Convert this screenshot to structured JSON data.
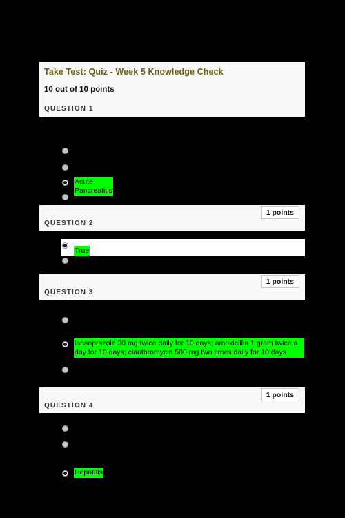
{
  "header": {
    "test_title": "Take Test: Quiz - Week 5 Knowledge Check",
    "points_total": "10 out of 10 points"
  },
  "colors": {
    "page_background": "#000000",
    "panel_background": "#f8f8f8",
    "title_color": "#6b5f15",
    "highlight_green": "#00ff00",
    "label_color": "#3a3a3a"
  },
  "questions": [
    {
      "label": "QUESTION 1",
      "points": "",
      "options": [
        {
          "text": "",
          "selected": false
        },
        {
          "text": "",
          "selected": false
        },
        {
          "text": "Acute Pancreatitis",
          "selected": true
        },
        {
          "text": "",
          "selected": false
        }
      ]
    },
    {
      "label": "QUESTION 2",
      "points": "1 points",
      "options": [
        {
          "text": "True",
          "selected": true
        },
        {
          "text": "",
          "selected": false
        }
      ]
    },
    {
      "label": "QUESTION 3",
      "points": "1 points",
      "options": [
        {
          "text": "",
          "selected": false
        },
        {
          "text": "lansoprazole 30 mg twice daily for 10 days; amoxicillin 1 gram twice a day for 10 days; clarithromycin 500 mg two times daily for 10 days",
          "selected": true
        },
        {
          "text": "",
          "selected": false
        }
      ]
    },
    {
      "label": "QUESTION 4",
      "points": "1 points",
      "options": [
        {
          "text": "",
          "selected": false
        },
        {
          "text": "",
          "selected": false
        },
        {
          "text": "Hepatitis",
          "selected": true
        }
      ]
    }
  ]
}
